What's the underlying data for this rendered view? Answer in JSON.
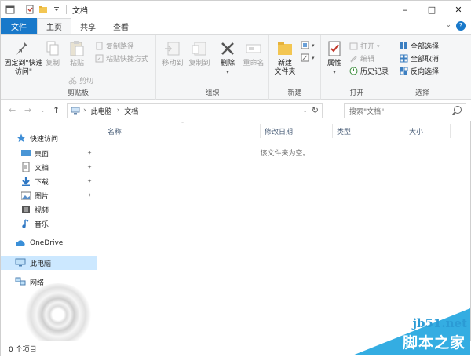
{
  "window": {
    "title": "文档",
    "controls": [
      "minimize-icon",
      "maximize-icon",
      "close-icon"
    ]
  },
  "quick_access_icons": [
    "properties-icon",
    "new-folder-icon",
    "customize-dropdown-icon"
  ],
  "tabs": [
    {
      "label": "文件",
      "kind": "file"
    },
    {
      "label": "主页",
      "kind": "active"
    },
    {
      "label": "共享",
      "kind": "normal"
    },
    {
      "label": "查看",
      "kind": "normal"
    }
  ],
  "ribbon": {
    "clipboard": {
      "label": "剪贴板",
      "pin": "固定到\"快速访问\"",
      "copy": "复制",
      "paste": "粘贴",
      "copy_path": "复制路径",
      "paste_shortcut": "粘贴快捷方式",
      "cut": "剪切"
    },
    "organize": {
      "label": "组织",
      "move_to": "移动到",
      "copy_to": "复制到",
      "delete": "删除",
      "rename": "重命名"
    },
    "new": {
      "label": "新建",
      "new_folder": "新建",
      "new_folder_line2": "文件夹"
    },
    "open": {
      "label": "打开",
      "properties": "属性",
      "open": "打开",
      "edit": "编辑",
      "history": "历史记录"
    },
    "select": {
      "label": "选择",
      "select_all": "全部选择",
      "select_none": "全部取消",
      "invert": "反向选择"
    }
  },
  "address": {
    "crumbs": [
      "此电脑",
      "文档"
    ],
    "search_placeholder": "搜索\"文档\""
  },
  "nav": {
    "quick_access": "快速访问",
    "desktop": "桌面",
    "documents": "文档",
    "downloads": "下载",
    "pictures": "图片",
    "videos": "视频",
    "music": "音乐",
    "onedrive": "OneDrive",
    "this_pc": "此电脑",
    "network": "网络"
  },
  "columns": {
    "name": "名称",
    "date": "修改日期",
    "type": "类型",
    "size": "大小"
  },
  "empty_message": "该文件夹为空。",
  "status": {
    "item_count": "0 个项目"
  },
  "watermark": {
    "site": "jb51.net",
    "brand": "脚本之家"
  },
  "colors": {
    "accent": "#1979ca",
    "selected_nav": "#cce8ff",
    "watermark": "#29a9e0"
  }
}
